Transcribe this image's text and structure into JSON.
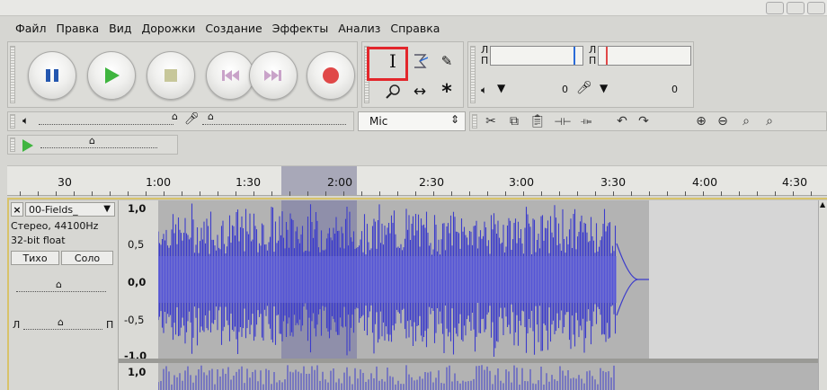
{
  "menu": [
    "Файл",
    "Правка",
    "Вид",
    "Дорожки",
    "Создание",
    "Эффекты",
    "Анализ",
    "Справка"
  ],
  "meters": {
    "rec_left": "Л",
    "rec_right": "П",
    "play_left": "Л",
    "play_right": "П",
    "rec_value": "0",
    "play_value": "0"
  },
  "mixer": {
    "input_source": "Mic"
  },
  "ruler": {
    "labels": [
      "30",
      "1:00",
      "1:30",
      "2:00",
      "2:30",
      "3:00",
      "3:30",
      "4:00",
      "4:30"
    ]
  },
  "track": {
    "name": "00-Fields_",
    "format": "Стерео, 44100Hz",
    "bits": "32-bit float",
    "mute_label": "Тихо",
    "solo_label": "Соло",
    "pan_left": "Л",
    "pan_right": "П",
    "scale": [
      "1,0",
      "0,5",
      "0,0",
      "-0,5",
      "-1,0"
    ],
    "scale2_top": "1,0"
  },
  "colors": {
    "waveform": "#3c3ccb",
    "selection_highlight": "#e3262b",
    "track_border": "#d8c36a"
  }
}
